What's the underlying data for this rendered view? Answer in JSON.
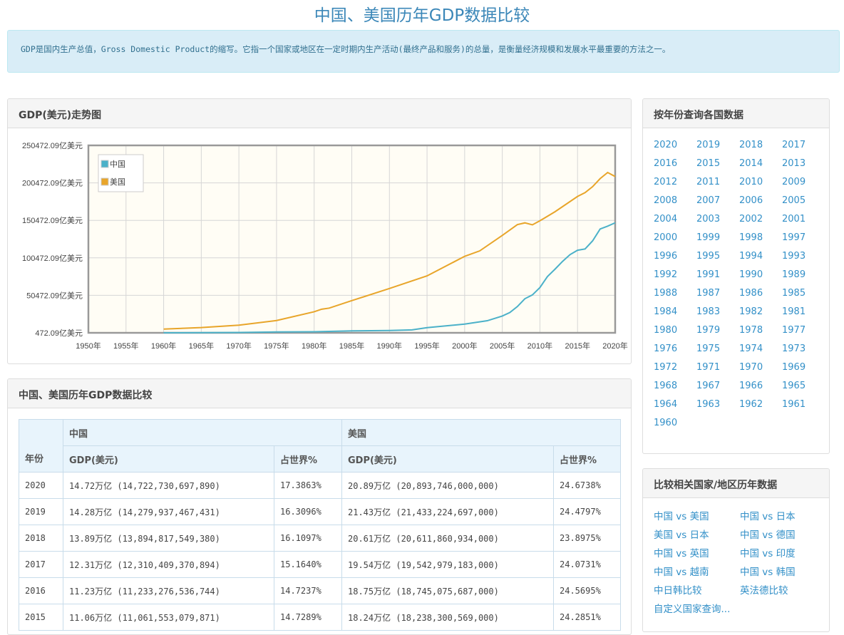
{
  "title": "中国、美国历年GDP数据比较",
  "info": "GDP是国内生产总值，Gross Domestic Product的缩写。它指一个国家或地区在一定时期内生产活动(最终产品和服务)的总量，是衡量经济规模和发展水平最重要的方法之一。",
  "chart_panel": {
    "title": "GDP(美元)走势图"
  },
  "chart_data": {
    "type": "line",
    "ylabel_unit": "亿美元",
    "yticks": [
      "472.09亿美元",
      "50472.09亿美元",
      "100472.09亿美元",
      "150472.09亿美元",
      "200472.09亿美元",
      "250472.09亿美元"
    ],
    "ylim": [
      472.09,
      250472.09
    ],
    "xticks": [
      "1950年",
      "1955年",
      "1960年",
      "1965年",
      "1970年",
      "1975年",
      "1980年",
      "1985年",
      "1990年",
      "1995年",
      "2000年",
      "2005年",
      "2010年",
      "2015年",
      "2020年"
    ],
    "xlim": [
      1950,
      2020
    ],
    "legend": "top-left",
    "grid": true,
    "series": [
      {
        "name": "中国",
        "color": "#4bb1c9",
        "x": [
          1960,
          1965,
          1970,
          1975,
          1980,
          1985,
          1990,
          1993,
          1995,
          2000,
          2003,
          2005,
          2006,
          2007,
          2008,
          2009,
          2010,
          2011,
          2012,
          2013,
          2014,
          2015,
          2016,
          2017,
          2018,
          2019,
          2020
        ],
        "values": [
          597,
          704,
          927,
          1634,
          1911,
          3094,
          3609,
          4447,
          7340,
          12113,
          16603,
          22860,
          27521,
          35500,
          45940,
          51020,
          60870,
          75520,
          85320,
          95700,
          104760,
          110616,
          112333,
          123104,
          138948,
          142799,
          147227
        ]
      },
      {
        "name": "美国",
        "color": "#e8a52a",
        "x": [
          1960,
          1965,
          1970,
          1975,
          1980,
          1981,
          1982,
          1985,
          1990,
          1995,
          2000,
          2002,
          2005,
          2007,
          2008,
          2009,
          2010,
          2012,
          2015,
          2016,
          2017,
          2018,
          2019,
          2020
        ],
        "values": [
          5433,
          7438,
          10730,
          16848,
          28573,
          31979,
          33437,
          43389,
          59631,
          76399,
          102500,
          109775,
          130370,
          144770,
          147130,
          144490,
          149920,
          161970,
          182380,
          187450,
          195430,
          206120,
          214330,
          208940
        ]
      }
    ]
  },
  "table_panel": {
    "title": "中国、美国历年GDP数据比较",
    "headers": {
      "year": "年份",
      "cn": "中国",
      "us": "美国",
      "gdp": "GDP(美元)",
      "share": "占世界%"
    },
    "rows": [
      [
        "2020",
        "14.72万亿 (14,722,730,697,890)",
        "17.3863%",
        "20.89万亿 (20,893,746,000,000)",
        "24.6738%"
      ],
      [
        "2019",
        "14.28万亿 (14,279,937,467,431)",
        "16.3096%",
        "21.43万亿 (21,433,224,697,000)",
        "24.4797%"
      ],
      [
        "2018",
        "13.89万亿 (13,894,817,549,380)",
        "16.1097%",
        "20.61万亿 (20,611,860,934,000)",
        "23.8975%"
      ],
      [
        "2017",
        "12.31万亿 (12,310,409,370,894)",
        "15.1640%",
        "19.54万亿 (19,542,979,183,000)",
        "24.0731%"
      ],
      [
        "2016",
        "11.23万亿 (11,233,276,536,744)",
        "14.7237%",
        "18.75万亿 (18,745,075,687,000)",
        "24.5695%"
      ],
      [
        "2015",
        "11.06万亿 (11,061,553,079,871)",
        "14.7289%",
        "18.24万亿 (18,238,300,569,000)",
        "24.2851%"
      ]
    ]
  },
  "years_panel": {
    "title": "按年份查询各国数据",
    "years": [
      "2020",
      "2019",
      "2018",
      "2017",
      "2016",
      "2015",
      "2014",
      "2013",
      "2012",
      "2011",
      "2010",
      "2009",
      "2008",
      "2007",
      "2006",
      "2005",
      "2004",
      "2003",
      "2002",
      "2001",
      "2000",
      "1999",
      "1998",
      "1997",
      "1996",
      "1995",
      "1994",
      "1993",
      "1992",
      "1991",
      "1990",
      "1989",
      "1988",
      "1987",
      "1986",
      "1985",
      "1984",
      "1983",
      "1982",
      "1981",
      "1980",
      "1979",
      "1978",
      "1977",
      "1976",
      "1975",
      "1974",
      "1973",
      "1972",
      "1971",
      "1970",
      "1969",
      "1968",
      "1967",
      "1966",
      "1965",
      "1964",
      "1963",
      "1962",
      "1961",
      "1960"
    ]
  },
  "compare_panel": {
    "title": "比较相关国家/地区历年数据",
    "links": [
      "中国 vs 美国",
      "中国 vs 日本",
      "美国 vs 日本",
      "中国 vs 德国",
      "中国 vs 英国",
      "中国 vs 印度",
      "中国 vs 越南",
      "中国 vs 韩国",
      "中日韩比较",
      "英法德比较",
      "自定义国家查询..."
    ]
  }
}
